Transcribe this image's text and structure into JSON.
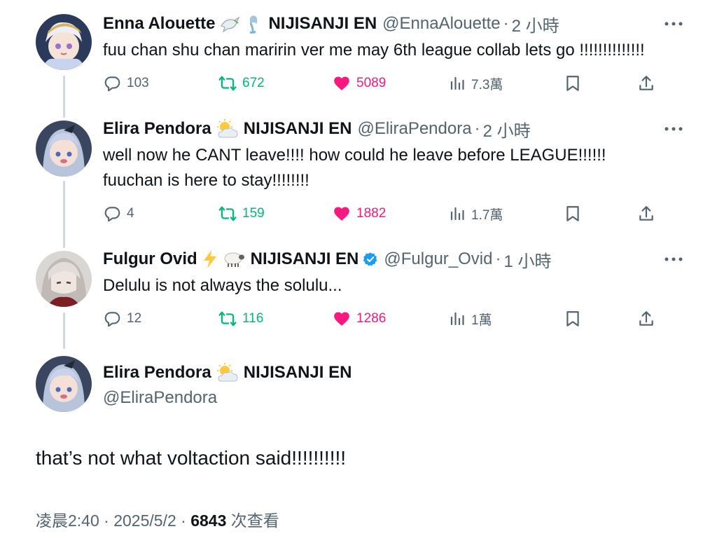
{
  "tweets": [
    {
      "name": "Enna Alouette",
      "emoji1": "dove-emoji",
      "emoji2": "mermaid-emoji",
      "affiliation": "NIJISANJI EN",
      "handle": "@EnnaAlouette",
      "separator": "·",
      "time": "2 小時",
      "text": "fuu chan shu chan maririn ver me may 6th league collab lets go !!!!!!!!!!!!!!",
      "replies": "103",
      "retweets": "672",
      "likes": "5089",
      "views": "7.3萬"
    },
    {
      "name": "Elira Pendora",
      "emoji1": "sun-behind-cloud-emoji",
      "affiliation": "NIJISANJI EN",
      "handle": "@EliraPendora",
      "separator": "·",
      "time": "2 小時",
      "text_line1": "well now he CANT leave!!!! how could he leave before LEAGUE!!!!!!",
      "text_line2": "fuuchan is here to stay!!!!!!!!",
      "replies": "4",
      "retweets": "159",
      "likes": "1882",
      "views": "1.7萬"
    },
    {
      "name": "Fulgur Ovid",
      "emoji1": "lightning-emoji",
      "emoji2": "sheep-emoji",
      "affiliation": "NIJISANJI EN",
      "verified": true,
      "handle": "@Fulgur_Ovid",
      "separator": "·",
      "time": "1 小時",
      "text": "Delulu is not always the solulu...",
      "replies": "12",
      "retweets": "116",
      "likes": "1286",
      "views": "1萬"
    }
  ],
  "main_tweet": {
    "name": "Elira Pendora",
    "emoji1": "sun-behind-cloud-emoji",
    "affiliation": "NIJISANJI EN",
    "handle": "@EliraPendora",
    "text": "that’s not what voltaction said!!!!!!!!!!",
    "time": "凌晨2:40",
    "date": "2025/5/2",
    "separator": "·",
    "views_count": "6843",
    "views_label": "次查看"
  },
  "colors": {
    "text": "#0f1419",
    "secondary": "#536471",
    "retweet": "#00ba7c",
    "like": "#f91880",
    "verified": "#1d9bf0",
    "thread_line": "#cfd9de"
  }
}
